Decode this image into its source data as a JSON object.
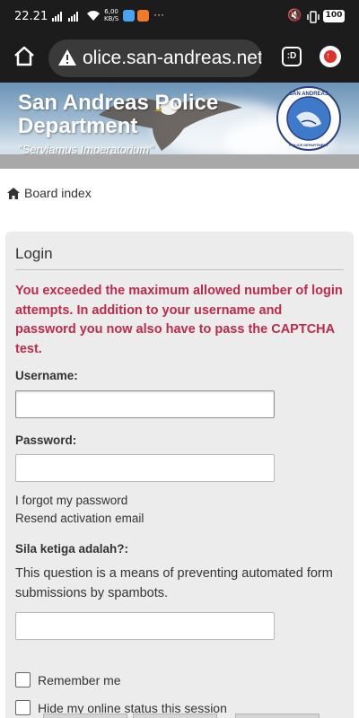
{
  "status_bar": {
    "time": "22.21",
    "net_speed_value": "6,00",
    "net_speed_unit": "KB/S",
    "more": "···",
    "battery": "100"
  },
  "browser": {
    "url": "olice.san-andreas.net",
    "tabs_label": ":D"
  },
  "site": {
    "title": "San Andreas Police Department",
    "motto": "\"Serviamus Imperatorium\"",
    "seal_top_text": "SAN ANDREAS",
    "seal_bottom_text": "POLICE DEPARTMENT"
  },
  "breadcrumb": {
    "label": "Board index"
  },
  "login": {
    "title": "Login",
    "error": "You exceeded the maximum allowed number of login attempts. In addition to your username and password you now also have to pass the CAPTCHA test.",
    "username_label": "Username:",
    "username_value": "",
    "password_label": "Password:",
    "password_value": "",
    "forgot_link": "I forgot my password",
    "resend_link": "Resend activation email",
    "captcha_label": "Sila ketiga adalah?:",
    "captcha_explain": "This question is a means of preventing automated form submissions by spambots.",
    "captcha_value": "",
    "remember_label": "Remember me",
    "hide_label": "Hide my online status this session"
  },
  "colors": {
    "error": "#bc2a4d",
    "panel_bg": "#ececec",
    "browser_chrome": "#1c1c1c"
  },
  "icons": {
    "home": "home-icon",
    "warning": "warning-icon",
    "breadcrumb": "home-icon"
  }
}
